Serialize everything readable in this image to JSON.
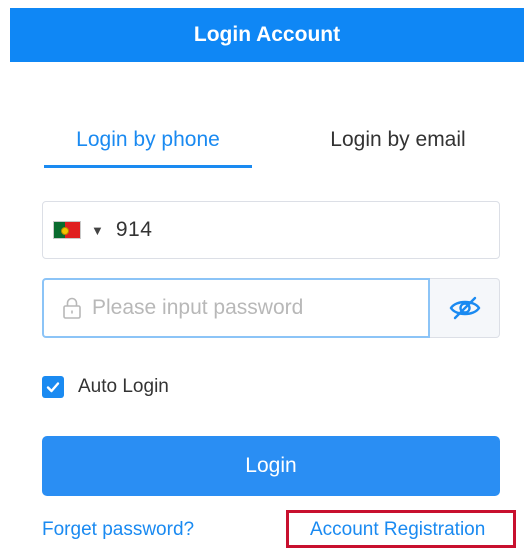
{
  "header": {
    "title": "Login Account"
  },
  "tabs": [
    {
      "label": "Login by phone",
      "active": true
    },
    {
      "label": "Login by email",
      "active": false
    }
  ],
  "phone": {
    "country_flag": "portugal-flag-icon",
    "dropdown_icon": "caret-down-icon",
    "value": "914"
  },
  "password": {
    "placeholder": "Please input password",
    "value": "",
    "lock_icon": "lock-icon",
    "toggle_icon": "eye-slash-icon"
  },
  "auto_login": {
    "label": "Auto Login",
    "checked": true
  },
  "login_button": {
    "label": "Login"
  },
  "links": {
    "forget": "Forget password?",
    "register": "Account Registration"
  },
  "colors": {
    "primary": "#0f87f5",
    "accent_blue": "#1a8af1",
    "highlight_red": "#c8102e"
  }
}
